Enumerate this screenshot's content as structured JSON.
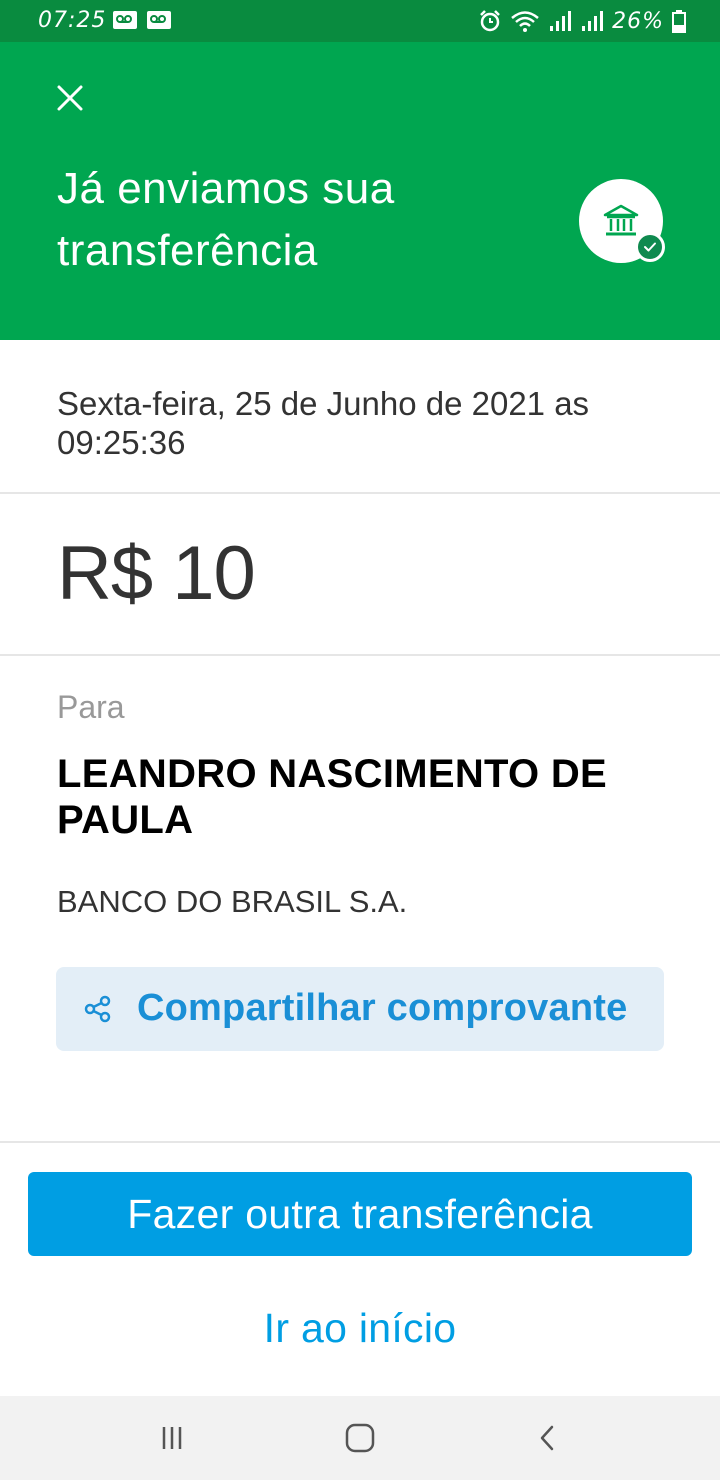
{
  "status_bar": {
    "time": "07:25",
    "battery": "26%"
  },
  "header": {
    "title": "Já enviamos sua transferência",
    "close_icon": "close-icon",
    "bank_icon": "bank-icon",
    "check_icon": "check-icon"
  },
  "transfer": {
    "datetime": "Sexta-feira, 25 de Junho de 2021 as 09:25:36",
    "amount": "R$ 10",
    "recipient_label": "Para",
    "recipient_name": "LEANDRO NASCIMENTO DE PAULA",
    "recipient_bank": "BANCO DO BRASIL S.A."
  },
  "actions": {
    "share_label": "Compartilhar comprovante",
    "share_icon": "share-icon",
    "new_transfer_label": "Fazer outra transferência",
    "home_label": "Ir ao início"
  },
  "colors": {
    "status_bar": "#098b3f",
    "header": "#00a650",
    "primary": "#009ee3",
    "share_bg": "#e3eef7"
  },
  "nav": {
    "recents_icon": "recents-icon",
    "home_icon": "home-icon",
    "back_icon": "back-icon"
  }
}
